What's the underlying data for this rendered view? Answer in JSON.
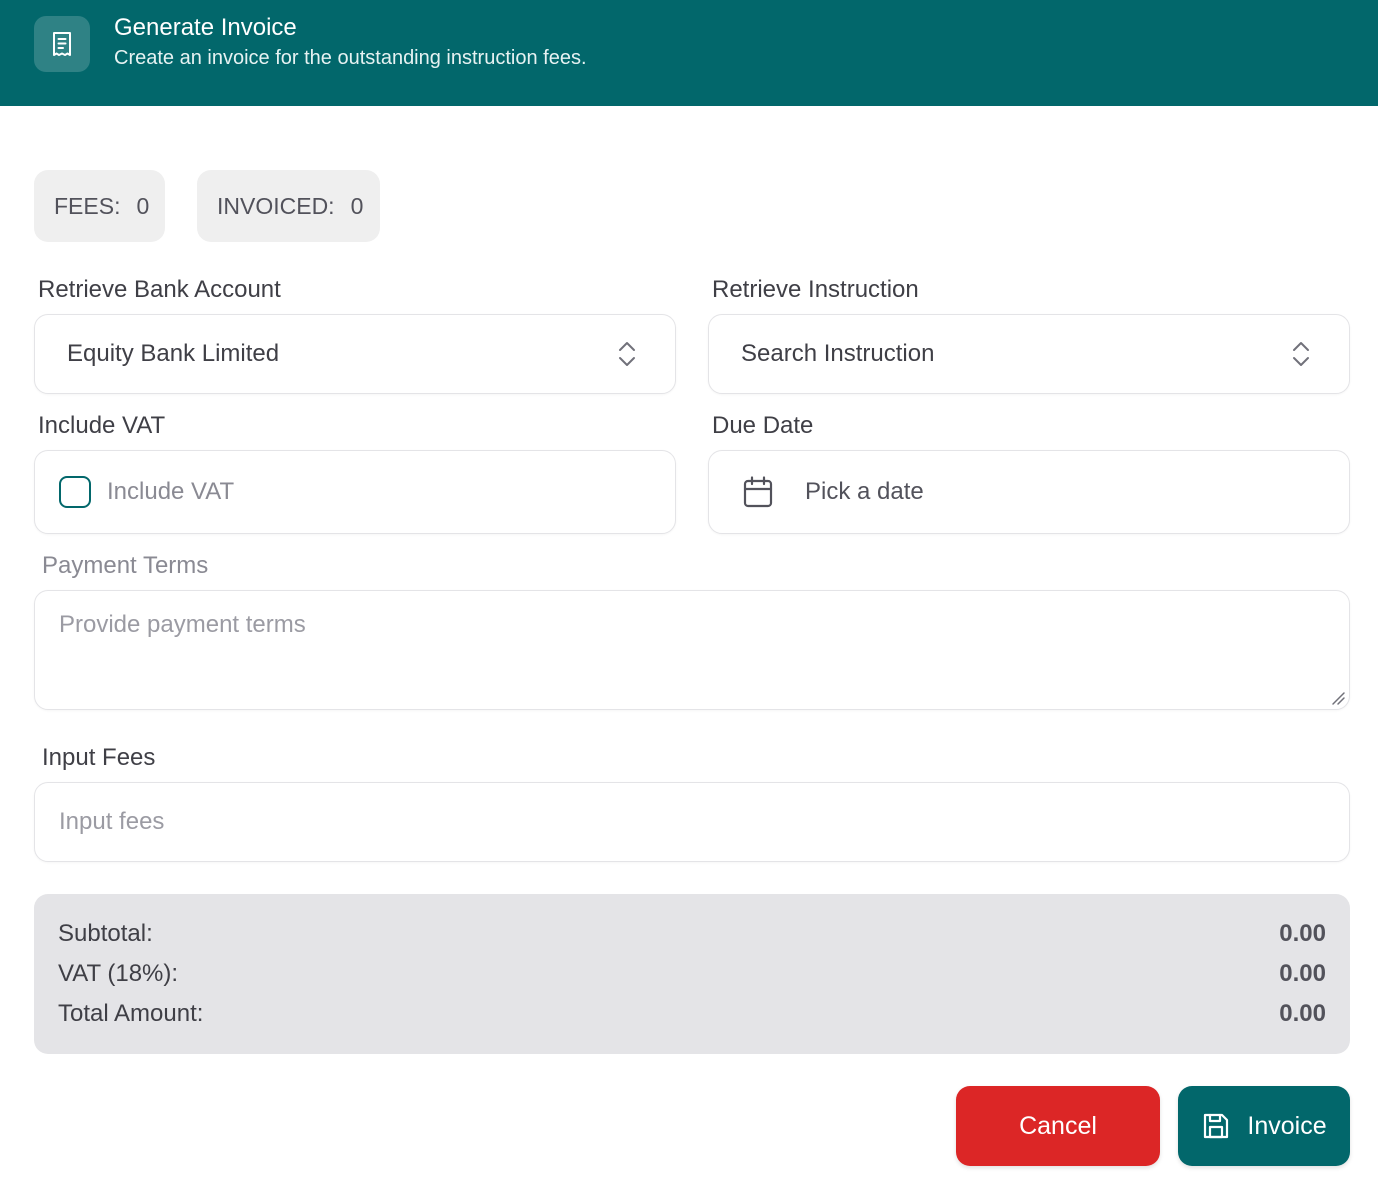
{
  "header": {
    "title": "Generate Invoice",
    "subtitle": "Create an invoice for the outstanding instruction fees.",
    "icon": "receipt-icon"
  },
  "stats": {
    "fees_label": "FEES:",
    "fees_value": "0",
    "invoiced_label": "INVOICED:",
    "invoiced_value": "0"
  },
  "form": {
    "bank_account": {
      "label": "Retrieve Bank Account",
      "value": "Equity Bank Limited"
    },
    "instruction": {
      "label": "Retrieve Instruction",
      "placeholder": "Search Instruction"
    },
    "vat": {
      "label": "Include VAT",
      "checkbox_label": "Include VAT",
      "checked": false
    },
    "due_date": {
      "label": "Due Date",
      "placeholder": "Pick a date"
    },
    "payment_terms": {
      "label": "Payment Terms",
      "placeholder": "Provide payment terms"
    },
    "input_fees": {
      "label": "Input Fees",
      "placeholder": "Input fees"
    }
  },
  "summary": {
    "subtotal_label": "Subtotal:",
    "subtotal_value": "0.00",
    "vat_label": "VAT (18%):",
    "vat_value": "0.00",
    "total_label": "Total Amount:",
    "total_value": "0.00"
  },
  "actions": {
    "cancel_label": "Cancel",
    "invoice_label": "Invoice"
  },
  "colors": {
    "primary": "#02676b",
    "danger": "#dc2626",
    "summary_bg": "#e4e4e7"
  }
}
